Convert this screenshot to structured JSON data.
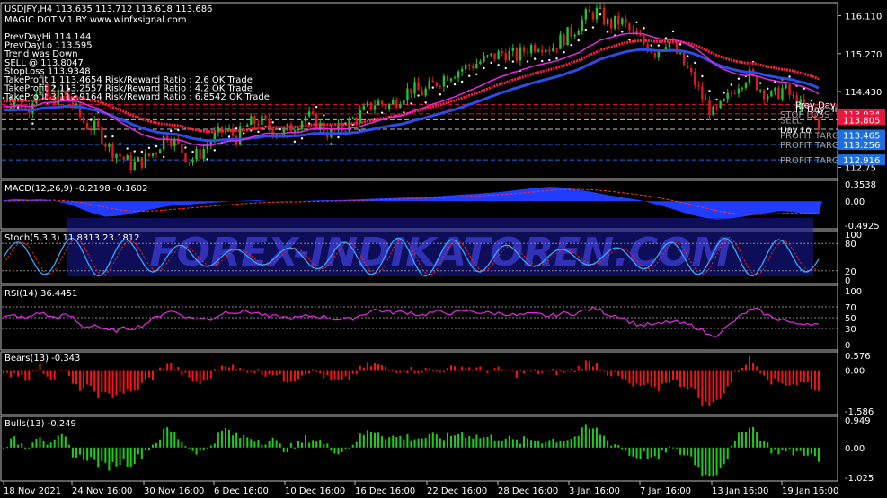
{
  "header": {
    "symbol_line": "USDJPY,H4  113.635 113.712 113.618 113.686",
    "indicator_line": "MAGIC DOT V.1 BY www.winfxsignal.com"
  },
  "info_lines": [
    "PrevDayHi 114.144",
    "PrevDayLo 113.595",
    "Trend was Down",
    "SELL @ 113.8047",
    "StopLoss 113.9348",
    "TakeProfit 1 113.4654 Risk/Reward Ratio : 2.6 OK Trade",
    "TakeProfit 2 113.2557 Risk/Reward Ratio : 4.2 OK Trade",
    "TakeProfit 3 112.9164 Risk/Reward Ratio : 6.8542 OK Trade"
  ],
  "watermark": "FOREX-INDIKATOREN.COM",
  "level_labels": [
    {
      "text": "Prev Day",
      "price": 114.144
    },
    {
      "text": "Pr Day Hi",
      "price": 114.05
    },
    {
      "text": "STOP LOSS",
      "price": 113.934
    },
    {
      "text": "SELL",
      "price": 113.805
    },
    {
      "text": "Day Lo",
      "price": 113.595
    },
    {
      "text": "PROFIT TARG",
      "price": 113.465
    },
    {
      "text": "PROFIT TARG",
      "price": 113.256
    },
    {
      "text": "PROFIT TARG",
      "price": 112.916
    }
  ],
  "price_tags": [
    {
      "text": "113.934",
      "price": 113.934,
      "color": "#e8163c"
    },
    {
      "text": "113.805",
      "price": 113.805,
      "color": "#e8163c"
    },
    {
      "text": "113.465",
      "price": 113.465,
      "color": "#1e6fe0"
    },
    {
      "text": "113.256",
      "price": 113.256,
      "color": "#1e6fe0"
    },
    {
      "text": "112.916",
      "price": 112.916,
      "color": "#1e6fe0"
    }
  ],
  "x_labels": [
    "18 Nov 2021",
    "24 Nov 16:00",
    "30 Nov 16:00",
    "6 Dec 16:00",
    "10 Dec 16:00",
    "16 Dec 16:00",
    "22 Dec 16:00",
    "28 Dec 16:00",
    "3 Jan 16:00",
    "7 Jan 16:00",
    "13 Jan 16:00",
    "19 Jan 16:00"
  ],
  "colors": {
    "bull": "#22c22e",
    "bear": "#e01818",
    "magenta": "#e628e6",
    "blue": "#2c4ce6",
    "sar": "#ffffff",
    "macd": "#1f3cff",
    "red_line": "#ff2040"
  },
  "chart_data": [
    {
      "type": "line",
      "title": "USDJPY,H4",
      "ylim": [
        112.5,
        116.4
      ],
      "yticks": [
        116.11,
        115.27,
        114.43,
        112.75
      ],
      "ytick_labels": [
        "116.110",
        "115.270",
        "114.430",
        "112.75"
      ],
      "series": [
        {
          "name": "close",
          "values": [
            114.1,
            114.3,
            114.0,
            114.6,
            114.2,
            114.4,
            114.1,
            113.7,
            113.6,
            113.2,
            113.0,
            112.8,
            112.9,
            113.1,
            113.5,
            113.2,
            112.9,
            113.1,
            113.4,
            113.6,
            113.4,
            113.7,
            113.8,
            113.6,
            113.5,
            113.7,
            113.9,
            113.7,
            113.5,
            113.6,
            113.8,
            114.0,
            114.2,
            114.1,
            114.3,
            114.5,
            114.4,
            114.6,
            114.8,
            114.9,
            115.0,
            115.1,
            115.2,
            115.3,
            115.2,
            115.4,
            115.5,
            115.4,
            115.6,
            115.8,
            116.1,
            116.2,
            115.9,
            116.0,
            115.7,
            115.5,
            115.3,
            115.6,
            115.2,
            114.8,
            114.3,
            113.9,
            114.2,
            114.6,
            114.8,
            114.5,
            114.3,
            114.5,
            114.2,
            114.0,
            113.7
          ]
        }
      ]
    },
    {
      "type": "bar",
      "title": "MACD(12,26,9) -0.2198 -0.1602",
      "ylim": [
        -0.4925,
        0.3538
      ],
      "ytick_labels": [
        "0.3538",
        "0.00",
        "-0.4925"
      ],
      "values": [
        0.02,
        0.05,
        0.03,
        0.04,
        0.0,
        -0.05,
        -0.15,
        -0.25,
        -0.32,
        -0.3,
        -0.26,
        -0.2,
        -0.15,
        -0.1,
        -0.08,
        -0.06,
        -0.04,
        -0.02,
        0.0,
        0.01,
        0.02,
        0.0,
        -0.01,
        0.0,
        0.01,
        0.02,
        0.02,
        0.03,
        0.04,
        0.05,
        0.06,
        0.07,
        0.08,
        0.09,
        0.1,
        0.12,
        0.14,
        0.15,
        0.17,
        0.19,
        0.22,
        0.25,
        0.28,
        0.3,
        0.28,
        0.24,
        0.2,
        0.15,
        0.1,
        0.06,
        0.02,
        -0.05,
        -0.12,
        -0.2,
        -0.28,
        -0.34,
        -0.38,
        -0.36,
        -0.32,
        -0.28,
        -0.24,
        -0.2,
        -0.22,
        -0.25,
        -0.28
      ]
    },
    {
      "type": "line",
      "title": "Stoch(5,3,3) 11.8313 23.1812",
      "ylim": [
        0,
        100
      ],
      "ytick_labels": [
        "100",
        "80",
        "20",
        "0"
      ]
    },
    {
      "type": "line",
      "title": "RSI(14) 36.4451",
      "ylim": [
        0,
        100
      ],
      "ytick_labels": [
        "100",
        "70",
        "50",
        "30",
        "0"
      ]
    },
    {
      "type": "bar",
      "title": "Bears(13) -0.343",
      "ylim": [
        -1.586,
        0.576
      ],
      "ytick_labels": [
        "0.576",
        "0.00",
        "-1.586"
      ]
    },
    {
      "type": "bar",
      "title": "Bulls(13) -0.249",
      "ylim": [
        -1.025,
        0.949
      ],
      "ytick_labels": [
        "0.949",
        "0.00",
        "-1.025"
      ]
    }
  ]
}
